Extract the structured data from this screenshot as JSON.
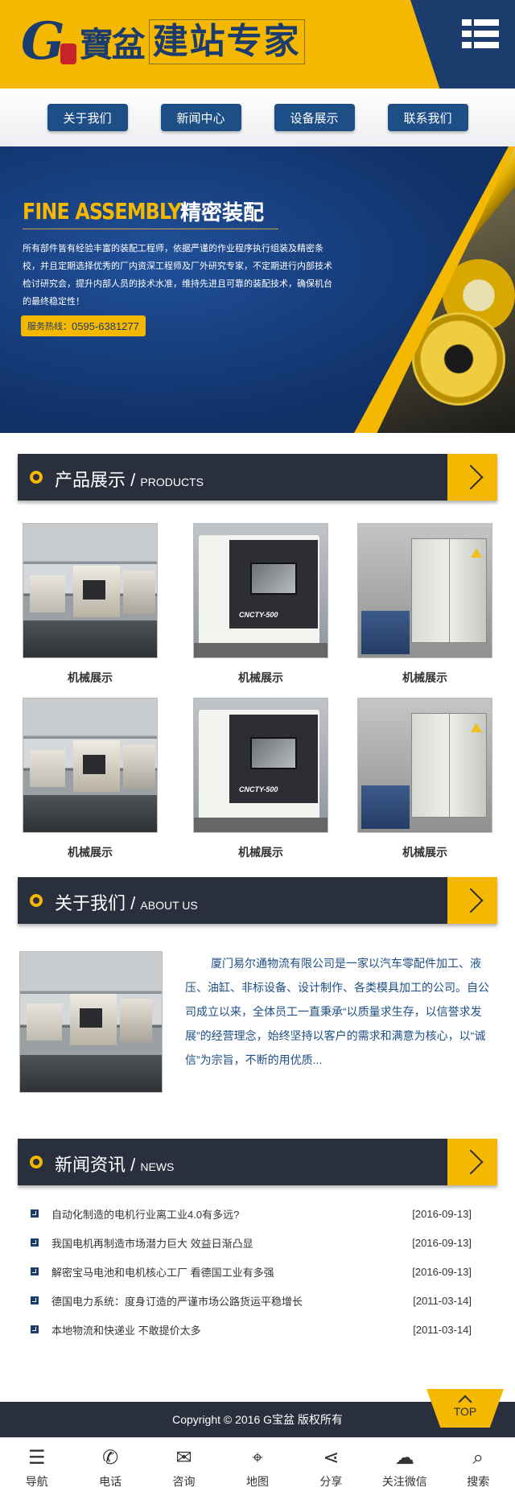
{
  "header": {
    "logo_mark": "G",
    "logo_brand": "寶盆",
    "logo_slogan": "建站专家",
    "menu_icon": "menu-grid-icon"
  },
  "nav": [
    "关于我们",
    "新闻中心",
    "设备展示",
    "联系我们"
  ],
  "banner": {
    "title_en": "FINE ASSEMBLY",
    "title_cn": "精密装配",
    "description": "所有部件皆有经验丰富的装配工程师，依据严谨的作业程序执行组装及精密条校，并且定期选择优秀的厂内资深工程师及厂外研究专家，不定期进行内部技术检讨研究会，提升内部人员的技术水准，维持先进且可靠的装配技术，确保机台的最终稳定性！",
    "hotline_label": "服务热线：",
    "hotline_number": "0595-6381277"
  },
  "sections": {
    "products": {
      "cn": "产品展示",
      "sep": "/",
      "en": "PRODUCTS"
    },
    "about": {
      "cn": "关于我们",
      "sep": "/",
      "en": "ABOUT US"
    },
    "news": {
      "cn": "新闻资讯",
      "sep": "/",
      "en": "NEWS"
    }
  },
  "products": [
    {
      "caption": "机械展示",
      "image": "factory"
    },
    {
      "caption": "机械展示",
      "image": "lathe",
      "label": "CNCTY-500"
    },
    {
      "caption": "机械展示",
      "image": "cabinet"
    },
    {
      "caption": "机械展示",
      "image": "factory"
    },
    {
      "caption": "机械展示",
      "image": "lathe",
      "label": "CNCTY-500"
    },
    {
      "caption": "机械展示",
      "image": "cabinet"
    }
  ],
  "about": {
    "text": "厦门易尔通物流有限公司是一家以汽车零配件加工、液压、油缸、非标设备、设计制作、各类模具加工的公司。自公司成立以来，全体员工一直秉承“以质量求生存，以信誉求发展”的经营理念，始终坚持以客户的需求和满意为核心，以“诚信”为宗旨，不断的用优质..."
  },
  "news": [
    {
      "title": "自动化制造的电机行业离工业4.0有多远?",
      "date": "[2016-09-13]"
    },
    {
      "title": "我国电机再制造市场潜力巨大 效益日渐凸显",
      "date": "[2016-09-13]"
    },
    {
      "title": "解密宝马电池和电机核心工厂 看德国工业有多强",
      "date": "[2016-09-13]"
    },
    {
      "title": "德国电力系统：度身订造的严谨市场公路货运平稳增长",
      "date": "[2011-03-14]"
    },
    {
      "title": "本地物流和快递业 不敢提价太多",
      "date": "[2011-03-14]"
    }
  ],
  "footer": {
    "top_label": "TOP",
    "copyright": "Copyright © 2016 G宝盆 版权所有"
  },
  "bottom_tabs": [
    {
      "label": "导航",
      "icon": "list-icon",
      "glyph": "☰"
    },
    {
      "label": "电话",
      "icon": "phone-icon",
      "glyph": "✆"
    },
    {
      "label": "咨询",
      "icon": "chat-icon",
      "glyph": "✉"
    },
    {
      "label": "地图",
      "icon": "map-icon",
      "glyph": "⌖"
    },
    {
      "label": "分享",
      "icon": "share-icon",
      "glyph": "⋖"
    },
    {
      "label": "关注微信",
      "icon": "wechat-icon",
      "glyph": "☁"
    },
    {
      "label": "搜索",
      "icon": "search-icon",
      "glyph": "⌕"
    }
  ],
  "colors": {
    "brand_yellow": "#f5b800",
    "brand_navy": "#1d3c6e",
    "section_dark": "#2a2f3d"
  }
}
